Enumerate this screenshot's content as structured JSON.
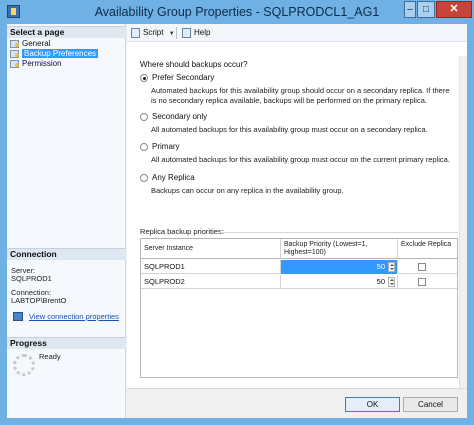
{
  "window": {
    "title": "Availability Group Properties - SQLPRODCL1_AG1",
    "controls": {
      "minimize": "‒",
      "maximize": "□",
      "close": "✕"
    }
  },
  "left_panel": {
    "select_page_header": "Select a page",
    "pages": [
      {
        "label": "General",
        "icon": "page-icon",
        "selected": false
      },
      {
        "label": "Backup Preferences",
        "icon": "page-icon",
        "selected": true
      },
      {
        "label": "Permission",
        "icon": "page-icon",
        "selected": false
      }
    ],
    "connection_header": "Connection",
    "server_label": "Server:",
    "server_value": "SQLPROD1",
    "connection_label": "Connection:",
    "connection_value": "LABTOP\\BrentO",
    "view_connection_link": "View connection properties",
    "progress_header": "Progress",
    "progress_status": "Ready"
  },
  "toolbar": {
    "script_label": "Script",
    "script_dropdown": "▼",
    "help_label": "Help"
  },
  "backup": {
    "question": "Where should backups occur?",
    "options": [
      {
        "label": "Prefer Secondary",
        "checked": true,
        "description": "Automated backups for this availability group should occur on a secondary replica. If there is no secondary replica available, backups will be performed on the primary replica."
      },
      {
        "label": "Secondary only",
        "checked": false,
        "description": "All automated backups for this availability group must occur on a secondary replica."
      },
      {
        "label": "Primary",
        "checked": false,
        "description": "All automated backups for this availability group must occur on the current primary replica."
      },
      {
        "label": "Any Replica",
        "checked": false,
        "description": "Backups can occur on any replica in the availability group."
      }
    ]
  },
  "replica_grid": {
    "label": "Replica backup priorities:",
    "headers": {
      "server_instance": "Server Instance",
      "priority": "Backup Priority (Lowest=1, Highest=100)",
      "exclude": "Exclude Replica"
    },
    "rows": [
      {
        "server": "SQLPROD1",
        "priority": "50",
        "exclude": false,
        "selected": true
      },
      {
        "server": "SQLPROD2",
        "priority": "50",
        "exclude": false,
        "selected": false
      }
    ]
  },
  "buttons": {
    "ok": "OK",
    "cancel": "Cancel"
  },
  "colors": {
    "title_bar": "#6fb1e5",
    "selection": "#3399ff",
    "close_button": "#c7443a",
    "link": "#1a4fb5"
  }
}
